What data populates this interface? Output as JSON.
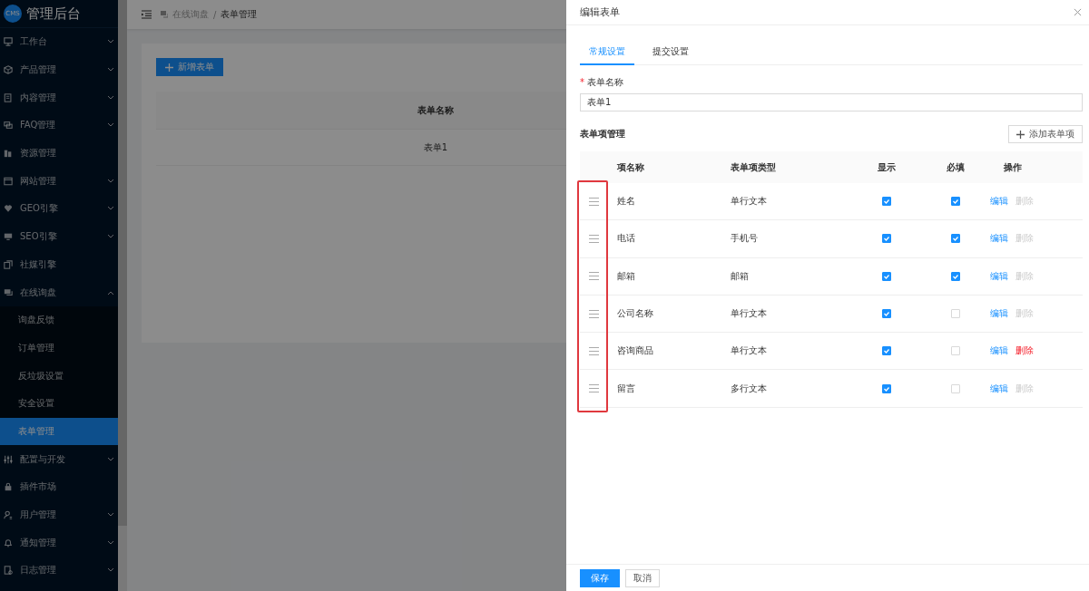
{
  "sidebar": {
    "logo": "CMS",
    "title": "管理后台",
    "items": [
      {
        "label": "工作台",
        "kind": "group",
        "expanded": false,
        "selected": false
      },
      {
        "label": "产品管理",
        "kind": "group",
        "expanded": false,
        "selected": false
      },
      {
        "label": "内容管理",
        "kind": "group",
        "expanded": false,
        "selected": false
      },
      {
        "label": "FAQ管理",
        "kind": "group",
        "expanded": false,
        "selected": false
      },
      {
        "label": "资源管理",
        "kind": "link",
        "selected": false
      },
      {
        "label": "网站管理",
        "kind": "group",
        "expanded": false,
        "selected": false
      },
      {
        "label": "GEO引擎",
        "kind": "group",
        "expanded": false,
        "selected": false
      },
      {
        "label": "SEO引擎",
        "kind": "group",
        "expanded": false,
        "selected": false
      },
      {
        "label": "社媒引擎",
        "kind": "link",
        "selected": false
      },
      {
        "label": "在线询盘",
        "kind": "group",
        "expanded": true,
        "selected": false,
        "children": [
          {
            "label": "询盘反馈",
            "selected": false
          },
          {
            "label": "订单管理",
            "selected": false
          },
          {
            "label": "反垃圾设置",
            "selected": false
          },
          {
            "label": "安全设置",
            "selected": false
          },
          {
            "label": "表单管理",
            "selected": true
          }
        ]
      },
      {
        "label": "配置与开发",
        "kind": "group",
        "expanded": false,
        "selected": false
      },
      {
        "label": "插件市场",
        "kind": "link",
        "selected": false
      },
      {
        "label": "用户管理",
        "kind": "group",
        "expanded": false,
        "selected": false
      },
      {
        "label": "通知管理",
        "kind": "group",
        "expanded": false,
        "selected": false
      },
      {
        "label": "日志管理",
        "kind": "group",
        "expanded": false,
        "selected": false
      }
    ]
  },
  "header": {
    "breadcrumb": [
      "在线询盘",
      "表单管理"
    ],
    "separator": "/"
  },
  "page": {
    "add_button": "新增表单",
    "table": {
      "columns": [
        "表单名称"
      ],
      "rows": [
        [
          "表单1"
        ]
      ]
    }
  },
  "drawer": {
    "title": "编辑表单",
    "tabs": [
      {
        "label": "常规设置",
        "selected": true
      },
      {
        "label": "提交设置",
        "selected": false
      }
    ],
    "field": {
      "required_mark": "*",
      "label": "表单名称",
      "value": "表单1"
    },
    "section_title": "表单项管理",
    "add_item_button": "添加表单项",
    "table": {
      "columns": [
        "项名称",
        "表单项类型",
        "显示",
        "必填",
        "操作"
      ],
      "rows": [
        {
          "name": "姓名",
          "type": "单行文本",
          "visible": true,
          "required": true,
          "edit": "编辑",
          "delete": "删除",
          "delete_enabled": false
        },
        {
          "name": "电话",
          "type": "手机号",
          "visible": true,
          "required": true,
          "edit": "编辑",
          "delete": "删除",
          "delete_enabled": false
        },
        {
          "name": "邮箱",
          "type": "邮箱",
          "visible": true,
          "required": true,
          "edit": "编辑",
          "delete": "删除",
          "delete_enabled": false
        },
        {
          "name": "公司名称",
          "type": "单行文本",
          "visible": true,
          "required": false,
          "edit": "编辑",
          "delete": "删除",
          "delete_enabled": false
        },
        {
          "name": "咨询商品",
          "type": "单行文本",
          "visible": true,
          "required": false,
          "edit": "编辑",
          "delete": "删除",
          "delete_enabled": true
        },
        {
          "name": "留言",
          "type": "多行文本",
          "visible": true,
          "required": false,
          "edit": "编辑",
          "delete": "删除",
          "delete_enabled": false
        }
      ]
    },
    "footer": {
      "save": "保存",
      "cancel": "取消"
    }
  }
}
